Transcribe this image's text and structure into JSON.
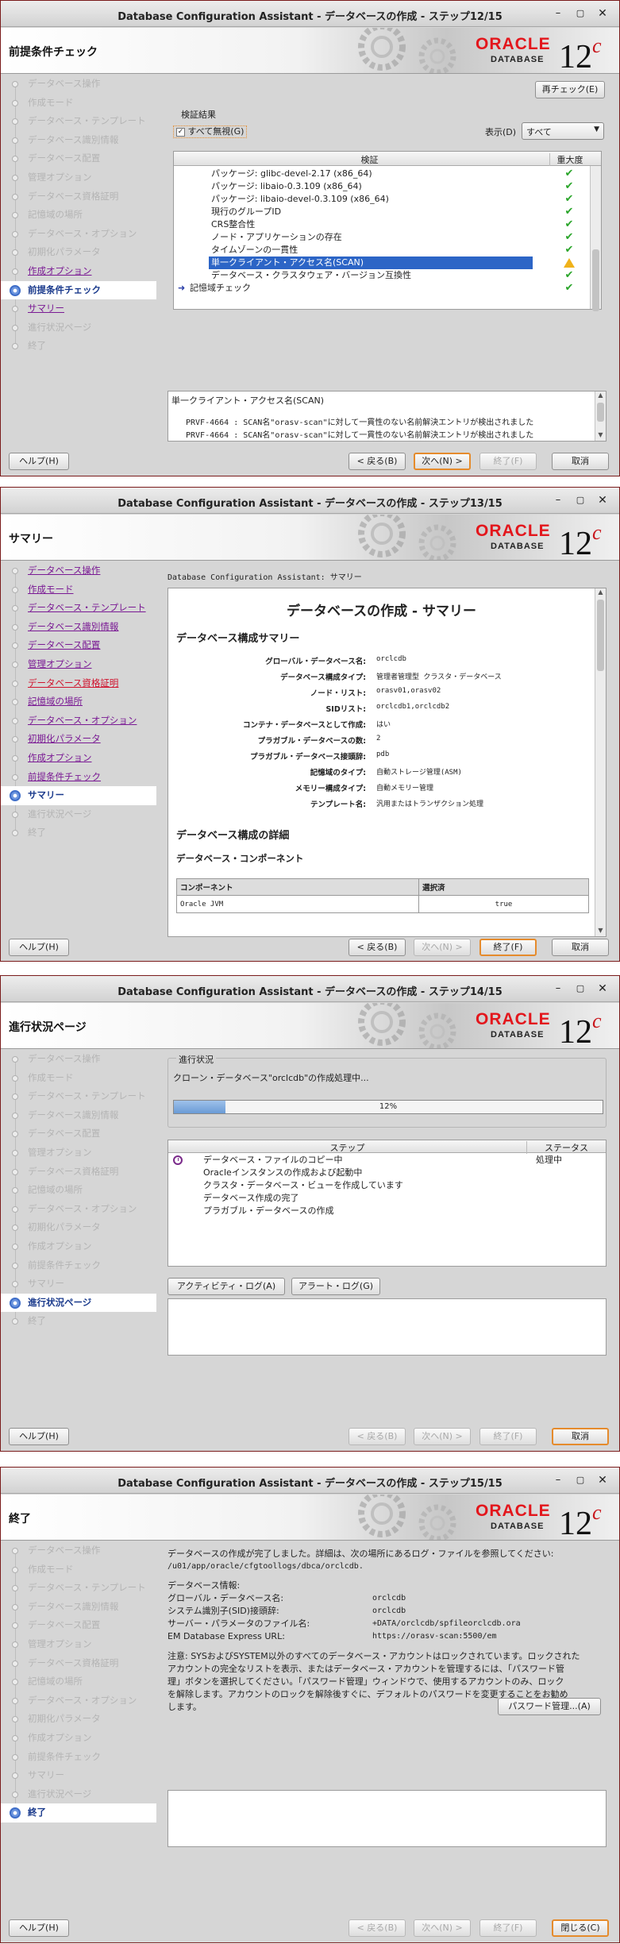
{
  "window_title_prefix": "Database Configuration Assistant - データベースの作成 - ステップ",
  "brand": {
    "oracle": "ORACLE",
    "database": "DATABASE",
    "version": "12",
    "version_suffix": "c",
    "accent": "#e3161c"
  },
  "window_controls": {
    "minimize": "–",
    "maximize": "▢",
    "close": "✕"
  },
  "step_labels": [
    "データベース操作",
    "作成モード",
    "データベース・テンプレート",
    "データベース識別情報",
    "データベース配置",
    "管理オプション",
    "データベース資格証明",
    "記憶域の場所",
    "データベース・オプション",
    "初期化パラメータ",
    "作成オプション",
    "前提条件チェック",
    "サマリー",
    "進行状況ページ",
    "終了"
  ],
  "common_buttons": {
    "help": "ヘルプ(H)",
    "back": "< 戻る(B)",
    "next": "次へ(N) >",
    "finish": "終了(F)",
    "cancel": "取消",
    "close": "閉じる(C)"
  },
  "windows": [
    {
      "title": "Database Configuration Assistant - データベースの作成 - ステップ12/15",
      "page_title": "前提条件チェック",
      "recheck_button": "再チェック(E)",
      "results_group": "検証結果",
      "ignore_all_label": "すべて無視(G)",
      "display_label": "表示(D)",
      "display_value": "すべて",
      "col_check": "検証",
      "col_severity": "重大度",
      "rows": [
        {
          "text": "パッケージ: glibc-devel-2.17 (x86_64)",
          "status": "ok"
        },
        {
          "text": "パッケージ: libaio-0.3.109 (x86_64)",
          "status": "ok"
        },
        {
          "text": "パッケージ: libaio-devel-0.3.109 (x86_64)",
          "status": "ok"
        },
        {
          "text": "現行のグループID",
          "status": "ok"
        },
        {
          "text": "CRS整合性",
          "status": "ok"
        },
        {
          "text": "ノード・アプリケーションの存在",
          "status": "ok"
        },
        {
          "text": "タイムゾーンの一貫性",
          "status": "ok"
        },
        {
          "text": "単一クライアント・アクセス名(SCAN)",
          "status": "warning",
          "selected": true
        },
        {
          "text": "データベース・クラスタウェア・バージョン互換性",
          "status": "ok"
        },
        {
          "text": "記憶域チェック",
          "status": "ok",
          "parent": true
        }
      ],
      "detail_title": "単一クライアント・アクセス名(SCAN)",
      "detail_lines": [
        "PRVF-4664 : SCAN名\"orasv-scan\"に対して一貫性のない名前解決エントリが検出されました",
        "PRVF-4664 : SCAN名\"orasv-scan\"に対して一貫性のない名前解決エントリが検出されました"
      ]
    },
    {
      "title": "Database Configuration Assistant - データベースの作成 - ステップ13/15",
      "page_title": "サマリー",
      "header_line": "Database Configuration Assistant: サマリー",
      "doc_title": "データベースの作成 - サマリー",
      "section1": "データベース構成サマリー",
      "summary": [
        {
          "k": "グローバル・データベース名:",
          "v": "orclcdb"
        },
        {
          "k": "データベース構成タイプ:",
          "v": "管理者管理型 クラスタ・データベース"
        },
        {
          "k": "ノード・リスト:",
          "v": "orasv01,orasv02"
        },
        {
          "k": "SIDリスト:",
          "v": "orclcdb1,orclcdb2"
        },
        {
          "k": "コンテナ・データベースとして作成:",
          "v": "はい"
        },
        {
          "k": "プラガブル・データベースの数:",
          "v": "2"
        },
        {
          "k": "プラガブル・データベース接頭辞:",
          "v": "pdb"
        },
        {
          "k": "記憶域のタイプ:",
          "v": "自動ストレージ管理(ASM)"
        },
        {
          "k": "メモリー構成タイプ:",
          "v": "自動メモリー管理"
        },
        {
          "k": "テンプレート名:",
          "v": "汎用またはトランザクション処理"
        }
      ],
      "section2": "データベース構成の詳細",
      "section3": "データベース・コンポーネント",
      "comp_col1": "コンポーネント",
      "comp_col2": "選択済",
      "comp_rows": [
        {
          "name": "Oracle JVM",
          "selected": "true"
        }
      ]
    },
    {
      "title": "Database Configuration Assistant - データベースの作成 - ステップ14/15",
      "page_title": "進行状況ページ",
      "progress_group": "進行状況",
      "progress_text": "クローン・データベース\"orclcdb\"の作成処理中...",
      "progress_value": 12,
      "progress_label": "12%",
      "col_step": "ステップ",
      "col_status": "ステータス",
      "step_rows": [
        {
          "text": "データベース・ファイルのコピー中",
          "status": "処理中",
          "active": true
        },
        {
          "text": "Oracleインスタンスの作成および起動中",
          "status": ""
        },
        {
          "text": "クラスタ・データベース・ビューを作成しています",
          "status": ""
        },
        {
          "text": "データベース作成の完了",
          "status": ""
        },
        {
          "text": "プラガブル・データベースの作成",
          "status": ""
        }
      ],
      "activity_log_button": "アクティビティ・ログ(A)",
      "alert_log_button": "アラート・ログ(G)"
    },
    {
      "title": "Database Configuration Assistant - データベースの作成 - ステップ15/15",
      "page_title": "終了",
      "msg1": "データベースの作成が完了しました。詳細は、次の場所にあるログ・ファイルを参照してください:",
      "log_path": "/u01/app/oracle/cfgtoollogs/dbca/orclcdb.",
      "db_info_label": "データベース情報:",
      "info": [
        {
          "k": "グローバル・データベース名:",
          "v": "orclcdb"
        },
        {
          "k": "システム識別子(SID)接頭辞:",
          "v": "orclcdb"
        },
        {
          "k": "サーバー・パラメータのファイル名:",
          "v": "+DATA/orclcdb/spfileorclcdb.ora"
        },
        {
          "k": "EM Database Express URL:",
          "v": "https://orasv-scan:5500/em"
        }
      ],
      "note_lines": [
        "注意: SYSおよびSYSTEM以外のすべてのデータベース・アカウントはロックされています。ロックされた",
        "アカウントの完全なリストを表示、またはデータベース・アカウントを管理するには、「パスワード管",
        "理」ボタンを選択してください。「パスワード管理」ウィンドウで、使用するアカウントのみ、ロック",
        "を解除します。アカウントのロックを解除後すぐに、デフォルトのパスワードを変更することをお勧め",
        "します。"
      ],
      "password_button": "パスワード管理...(A)"
    }
  ]
}
